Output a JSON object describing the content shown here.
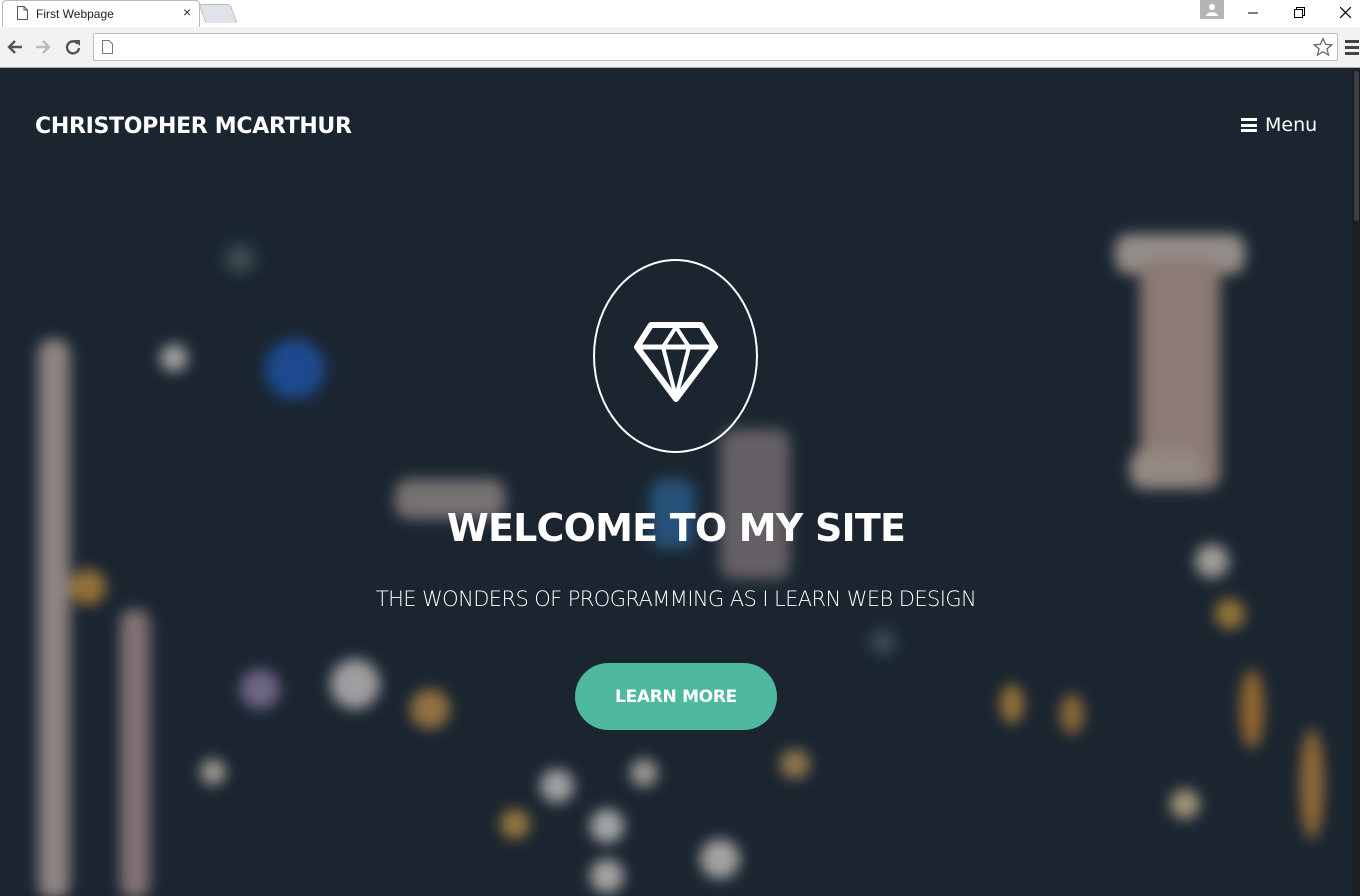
{
  "browser": {
    "tab_title": "First Webpage",
    "tab_close_glyph": "×",
    "address_value": "",
    "icons": [
      "page-icon",
      "close-icon",
      "new-tab-icon",
      "profile-icon",
      "minimize-icon",
      "maximize-icon",
      "window-close-icon",
      "back-icon",
      "forward-icon",
      "reload-icon",
      "star-icon",
      "chrome-menu-icon"
    ]
  },
  "site": {
    "brand": "CHRISTOPHER MCARTHUR",
    "menu_label": "Menu",
    "menu_icon": "hamburger-icon",
    "emblem_icon": "diamond-icon",
    "headline": "WELCOME TO MY SITE",
    "subheadline": "THE WONDERS OF PROGRAMMING AS I LEARN WEB DESIGN",
    "cta_label": "LEARN MORE"
  },
  "colors": {
    "accent": "#4fb9a0",
    "background": "#1b2631",
    "text": "#ffffff"
  }
}
